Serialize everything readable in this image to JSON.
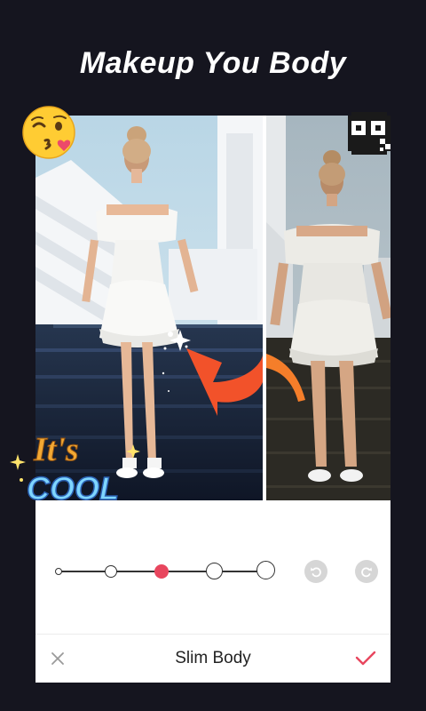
{
  "header": {
    "title": "Makeup You Body"
  },
  "stickers": {
    "line1": "It's",
    "line2": "COOL"
  },
  "tool": {
    "name": "Slim Body",
    "selected_level": 3,
    "levels": 5
  },
  "icons": {
    "kiss": "kissing-face-emoji-icon",
    "pixel": "pixel-face-emoji-icon",
    "undo": "undo-icon",
    "redo": "redo-icon",
    "cancel": "close-icon",
    "confirm": "checkmark-icon"
  },
  "colors": {
    "accent": "#e8465e",
    "background": "#15151f",
    "arrow": "#f2522a"
  }
}
